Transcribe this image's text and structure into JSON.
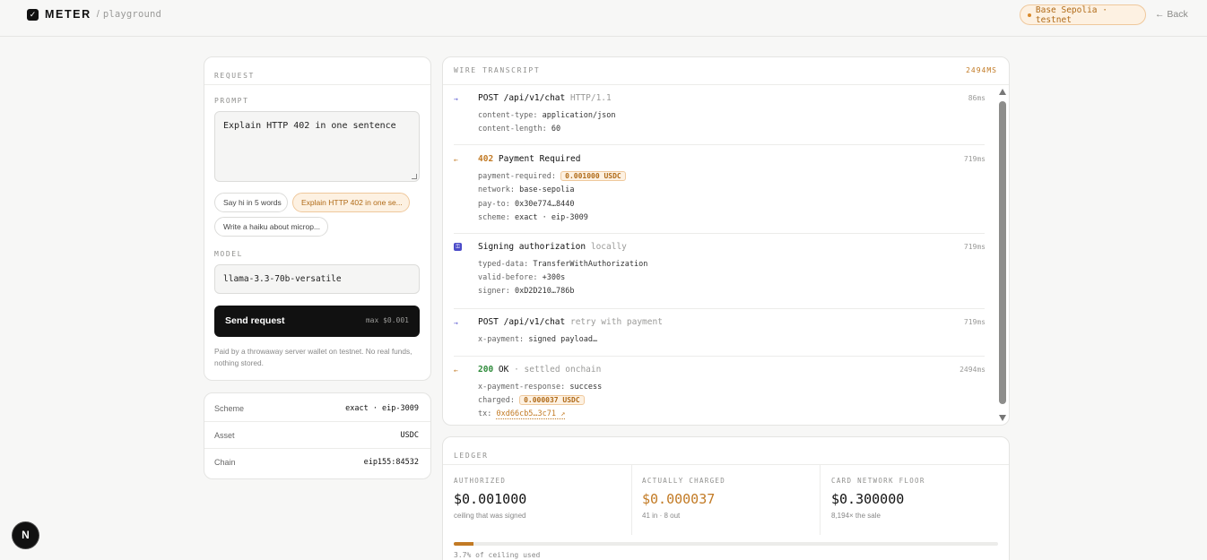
{
  "header": {
    "brand": "METER",
    "logo_glyph": "✓",
    "separator": "/",
    "subtitle": "playground",
    "network_badge": "Base Sepolia · testnet",
    "back_label": "← Back"
  },
  "request": {
    "title": "REQUEST",
    "prompt_label": "PROMPT",
    "prompt_value": "Explain HTTP 402 in one sentence",
    "suggestions": [
      "Say hi in 5 words",
      "Explain HTTP 402 in one se...",
      "Write a haiku about microp..."
    ],
    "active_suggestion": 1,
    "model_label": "MODEL",
    "model_value": "llama-3.3-70b-versatile",
    "send_label": "Send request",
    "send_max": "max $0.001",
    "footnote": "Paid by a throwaway server wallet on testnet. No real funds, nothing stored."
  },
  "scheme": [
    {
      "key": "Scheme",
      "value": "exact · eip-3009"
    },
    {
      "key": "Asset",
      "value": "USDC"
    },
    {
      "key": "Chain",
      "value": "eip155:84532"
    }
  ],
  "wire": {
    "title": "WIRE TRANSCRIPT",
    "total": "2494MS",
    "entries": [
      {
        "icon": "→",
        "title_main": "POST /api/v1/chat",
        "title_muted": "HTTP/1.1",
        "time": "86ms",
        "lines": [
          {
            "k": "content-type:",
            "v": "application/json"
          },
          {
            "k": "content-length:",
            "v": "60"
          }
        ]
      },
      {
        "icon": "←",
        "code": "402",
        "title_main": "Payment Required",
        "time": "719ms",
        "lines": [
          {
            "k": "payment-required:",
            "pill": "0.001000 USDC"
          },
          {
            "k": "network:",
            "v": "base-sepolia"
          },
          {
            "k": "pay-to:",
            "v": "0x30e774…8440"
          },
          {
            "k": "scheme:",
            "v": "exact · eip-3009"
          }
        ]
      },
      {
        "icon": "⚿",
        "title_main": "Signing authorization",
        "title_muted": "locally",
        "time": "719ms",
        "lines": [
          {
            "k": "typed-data:",
            "v": "TransferWithAuthorization"
          },
          {
            "k": "valid-before:",
            "v": "+300s"
          },
          {
            "k": "signer:",
            "v": "0xD2D210…786b"
          }
        ]
      },
      {
        "icon": "→",
        "title_main": "POST /api/v1/chat",
        "title_muted": "retry with payment",
        "time": "719ms",
        "lines": [
          {
            "k": "x-payment:",
            "v": "signed payload…"
          }
        ]
      },
      {
        "icon": "←",
        "code": "200",
        "title_main": "OK",
        "title_muted": "· settled onchain",
        "time": "2494ms",
        "lines": [
          {
            "k": "x-payment-response:",
            "v": "success"
          },
          {
            "k": "charged:",
            "pill": "0.000037 USDC"
          },
          {
            "k": "tx:",
            "link": "0xd66cb5…3c71 ↗"
          }
        ]
      }
    ]
  },
  "ledger": {
    "title": "LEDGER",
    "authorized_label": "AUTHORIZED",
    "authorized_value": "$0.001000",
    "authorized_sub": "ceiling that was signed",
    "charged_label": "ACTUALLY CHARGED",
    "charged_value": "$0.000037",
    "charged_sub": "41 in · 8 out",
    "floor_label": "CARD NETWORK FLOOR",
    "floor_value": "$0.300000",
    "floor_sub": "8,194× the sale",
    "progress_fraction": 0.037,
    "progress_label": "3.7% of ceiling used"
  },
  "fab": "N",
  "colors": {
    "accent": "#c27a24",
    "ok": "#2e8b3a",
    "signing": "#4b4bc8"
  }
}
